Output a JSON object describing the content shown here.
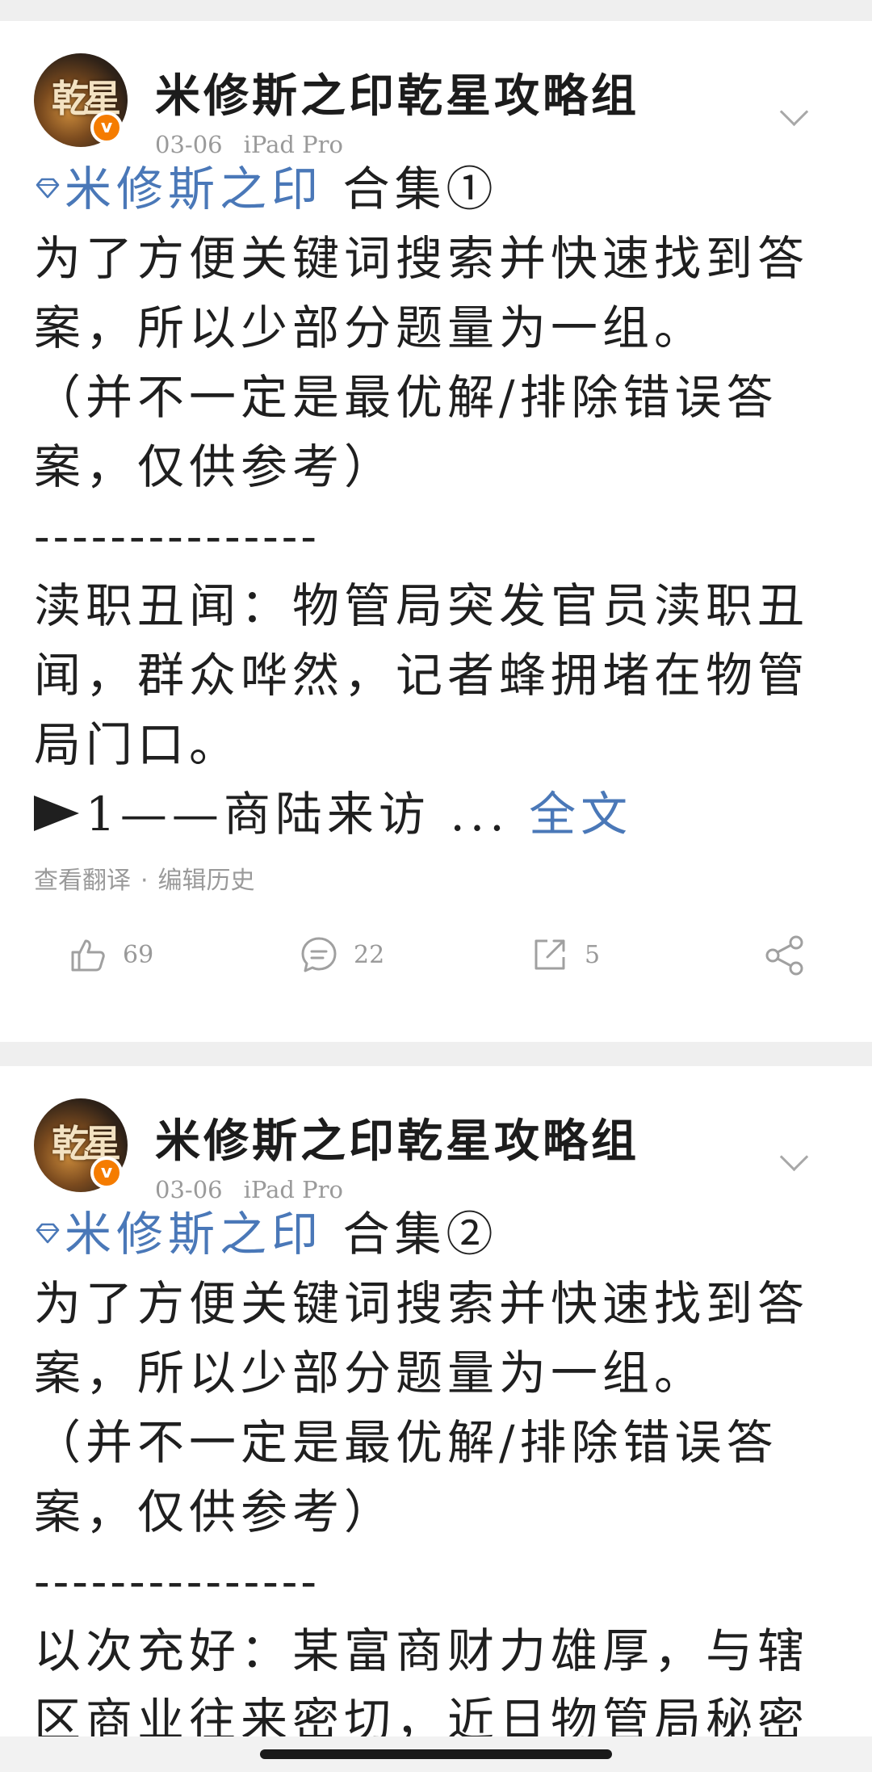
{
  "posts": [
    {
      "author": "米修斯之印乾星攻略组",
      "date": "03-06",
      "device": "iPad Pro",
      "avatar_text": "乾星",
      "topic": "米修斯之印",
      "collection": "合集①",
      "intro": "为了方便关键词搜索并快速找到答案，所以少部分题量为一组。",
      "note": "（并不一定是最优解/排除错误答案，仅供参考）",
      "divider": "---------------",
      "question": "渎职丑闻：物管局突发官员渎职丑闻，群众哗然，记者蜂拥堵在物管局门口。",
      "preview": "1——商陆来访",
      "ellipsis": "...",
      "full_text_link": "全文",
      "translate": "查看翻译",
      "edit_history": "编辑历史",
      "likes": "69",
      "comments": "22",
      "reposts": "5"
    },
    {
      "author": "米修斯之印乾星攻略组",
      "date": "03-06",
      "device": "iPad Pro",
      "avatar_text": "乾星",
      "topic": "米修斯之印",
      "collection": "合集②",
      "intro": "为了方便关键词搜索并快速找到答案，所以少部分题量为一组。",
      "note": "（并不一定是最优解/排除错误答案，仅供参考）",
      "divider": "---------------",
      "question": "以次充好：某富商财力雄厚，与辖区商业往来密切，近日物管局秘密"
    }
  ],
  "icons": {
    "topic": "diamond-topic-icon",
    "like": "thumb-up-icon",
    "comment": "comment-icon",
    "repost": "repost-icon",
    "share": "share-icon",
    "menu": "chevron-down-icon",
    "verified": "verified-badge-icon"
  },
  "colors": {
    "link": "#4a78b8",
    "verified": "#f57c00",
    "meta": "#9a9a9a"
  }
}
